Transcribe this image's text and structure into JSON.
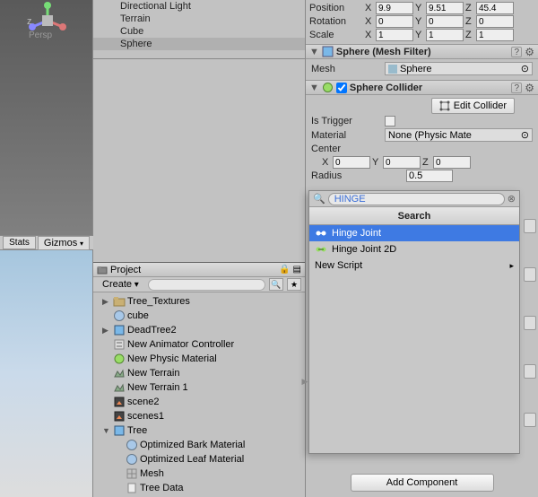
{
  "viewport": {
    "mode": "Persp"
  },
  "scene_toolbar": {
    "stats": "Stats",
    "gizmos": "Gizmos"
  },
  "hierarchy": {
    "items": [
      {
        "label": "Directional Light",
        "selected": false
      },
      {
        "label": "Terrain",
        "selected": false
      },
      {
        "label": "Cube",
        "selected": false
      },
      {
        "label": "Sphere",
        "selected": true
      }
    ]
  },
  "project": {
    "title": "Project",
    "create": "Create",
    "tree": [
      {
        "label": "Tree_Textures",
        "depth": 0,
        "foldable": true,
        "icon": "folder"
      },
      {
        "label": "cube",
        "depth": 0,
        "foldable": false,
        "icon": "material"
      },
      {
        "label": "DeadTree2",
        "depth": 0,
        "foldable": true,
        "icon": "prefab"
      },
      {
        "label": "New Animator Controller",
        "depth": 0,
        "foldable": false,
        "icon": "animator"
      },
      {
        "label": "New Physic Material",
        "depth": 0,
        "foldable": false,
        "icon": "physic"
      },
      {
        "label": "New Terrain",
        "depth": 0,
        "foldable": false,
        "icon": "terrain"
      },
      {
        "label": "New Terrain 1",
        "depth": 0,
        "foldable": false,
        "icon": "terrain"
      },
      {
        "label": "scene2",
        "depth": 0,
        "foldable": false,
        "icon": "scene"
      },
      {
        "label": "scenes1",
        "depth": 0,
        "foldable": false,
        "icon": "scene"
      },
      {
        "label": "Tree",
        "depth": 0,
        "foldable": true,
        "open": true,
        "icon": "prefab"
      },
      {
        "label": "Optimized Bark Material",
        "depth": 1,
        "foldable": false,
        "icon": "material"
      },
      {
        "label": "Optimized Leaf Material",
        "depth": 1,
        "foldable": false,
        "icon": "material"
      },
      {
        "label": "Mesh",
        "depth": 1,
        "foldable": false,
        "icon": "mesh"
      },
      {
        "label": "Tree Data",
        "depth": 1,
        "foldable": false,
        "icon": "data"
      }
    ]
  },
  "inspector": {
    "transform": {
      "position": {
        "label": "Position",
        "x": "9.9",
        "y": "9.51",
        "z": "45.4"
      },
      "rotation": {
        "label": "Rotation",
        "x": "0",
        "y": "0",
        "z": "0"
      },
      "scale": {
        "label": "Scale",
        "x": "1",
        "y": "1",
        "z": "1"
      }
    },
    "mesh_filter": {
      "title": "Sphere (Mesh Filter)",
      "mesh_label": "Mesh",
      "mesh_value": "Sphere"
    },
    "sphere_collider": {
      "title": "Sphere Collider",
      "edit_collider": "Edit Collider",
      "is_trigger": "Is Trigger",
      "material_label": "Material",
      "material_value": "None (Physic Mate",
      "center": "Center",
      "center_x": "0",
      "center_y": "0",
      "center_z": "0",
      "radius_label": "Radius",
      "radius_value": "0.5"
    },
    "add_component": "Add Component"
  },
  "search_popup": {
    "query": "HINGE",
    "header": "Search",
    "results": [
      {
        "label": "Hinge Joint",
        "selected": true
      },
      {
        "label": "Hinge Joint 2D",
        "selected": false
      },
      {
        "label": "New Script",
        "selected": false,
        "submenu": true
      }
    ]
  }
}
